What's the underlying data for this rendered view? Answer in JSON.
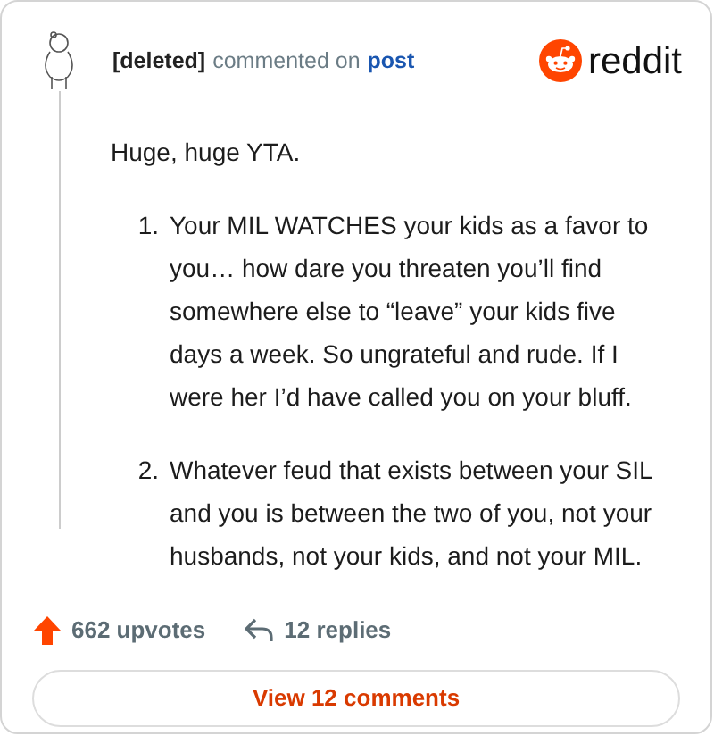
{
  "header": {
    "author": "[deleted]",
    "action": "commented on",
    "target": "post",
    "brand": "reddit"
  },
  "comment": {
    "intro": "Huge, huge YTA.",
    "items": [
      {
        "number": "1.",
        "text": "Your MIL WATCHES your kids as a favor to you… how dare you threaten you’ll find somewhere else to “leave” your kids five days a week. So ungrateful and rude. If I were her I’d have called you on your bluff."
      },
      {
        "number": "2.",
        "text": "Whatever feud that exists between your SIL and you is between the two of you, not your husbands, not your kids, and not your MIL."
      }
    ]
  },
  "stats": {
    "upvotes": "662 upvotes",
    "replies": "12 replies"
  },
  "button": "View 12 comments"
}
